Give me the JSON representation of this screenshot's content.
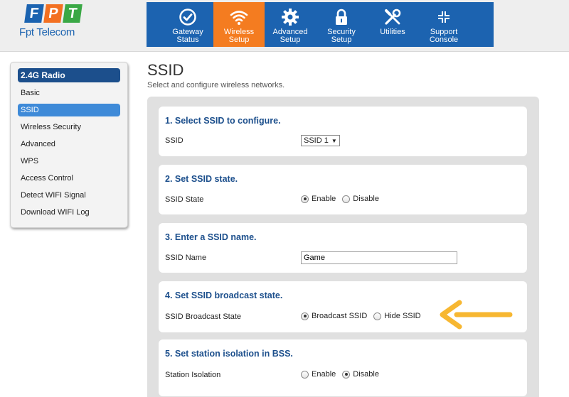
{
  "brand": {
    "letters": [
      "F",
      "P",
      "T"
    ],
    "name": "Fpt Telecom"
  },
  "nav": [
    {
      "label_1": "Gateway",
      "label_2": "Status",
      "icon": "check-circle-icon"
    },
    {
      "label_1": "Wireless",
      "label_2": "Setup",
      "icon": "wifi-icon",
      "active": true
    },
    {
      "label_1": "Advanced",
      "label_2": "Setup",
      "icon": "gear-icon"
    },
    {
      "label_1": "Security",
      "label_2": "Setup",
      "icon": "lock-icon"
    },
    {
      "label_1": "Utilities",
      "label_2": "",
      "icon": "tools-icon"
    },
    {
      "label_1": "Support",
      "label_2": "Console",
      "icon": "arrows-in-icon"
    }
  ],
  "sidebar": {
    "header": "2.4G Radio",
    "items": [
      {
        "label": "Basic"
      },
      {
        "label": "SSID",
        "active": true
      },
      {
        "label": "Wireless Security"
      },
      {
        "label": "Advanced"
      },
      {
        "label": "WPS"
      },
      {
        "label": "Access Control"
      },
      {
        "label": "Detect WIFI Signal"
      },
      {
        "label": "Download WIFI Log"
      }
    ]
  },
  "page": {
    "title": "SSID",
    "subtitle": "Select and configure wireless networks."
  },
  "sections": {
    "select_ssid": {
      "title": "1. Select SSID to configure.",
      "label": "SSID",
      "value": "SSID 1"
    },
    "ssid_state": {
      "title": "2. Set SSID state.",
      "label": "SSID State",
      "options": [
        "Enable",
        "Disable"
      ],
      "selected": "Enable"
    },
    "ssid_name": {
      "title": "3. Enter a SSID name.",
      "label": "SSID Name",
      "value": "Game"
    },
    "broadcast": {
      "title": "4. Set SSID broadcast state.",
      "label": "SSID Broadcast State",
      "options": [
        "Broadcast SSID",
        "Hide SSID"
      ],
      "selected": "Broadcast SSID"
    },
    "isolation": {
      "title": "5. Set station isolation in BSS.",
      "label": "Station Isolation",
      "options": [
        "Enable",
        "Disable"
      ],
      "selected": "Disable"
    }
  },
  "colors": {
    "nav_blue": "#1c63b0",
    "nav_active": "#f47c20",
    "section_title": "#1c4f8c",
    "annotation_arrow": "#f7b731"
  }
}
